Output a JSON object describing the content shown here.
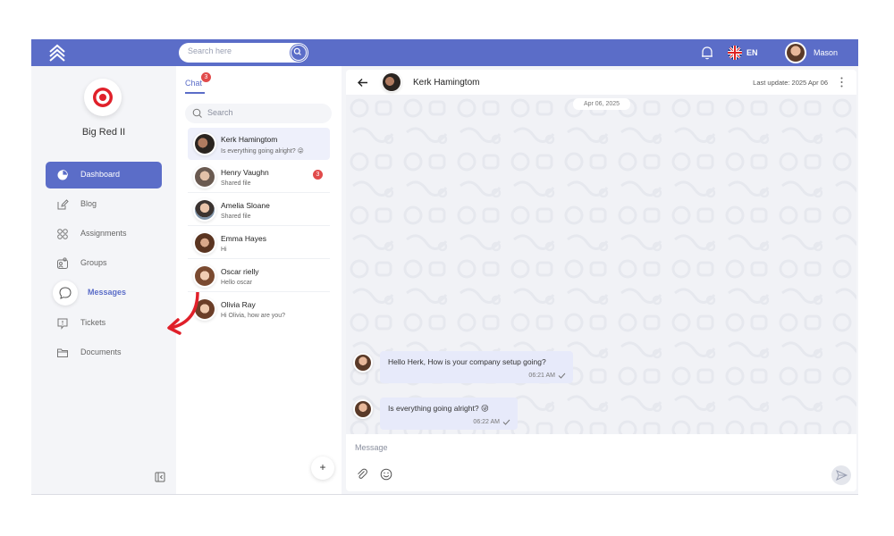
{
  "topbar": {
    "search_placeholder": "Search here",
    "language": "EN",
    "username": "Mason",
    "accent_color": "#5b6dc8"
  },
  "sidebar": {
    "brand_name": "Big Red II",
    "items": [
      {
        "label": "Dashboard",
        "icon": "pie-chart-icon"
      },
      {
        "label": "Blog",
        "icon": "edit-icon"
      },
      {
        "label": "Assignments",
        "icon": "grid-icon"
      },
      {
        "label": "Groups",
        "icon": "users-icon"
      },
      {
        "label": "Messages",
        "icon": "chat-bubble-icon"
      },
      {
        "label": "Tickets",
        "icon": "ticket-icon"
      },
      {
        "label": "Documents",
        "icon": "folder-icon"
      }
    ]
  },
  "chatlist": {
    "tab_label": "Chat",
    "tab_badge": "3",
    "search_placeholder": "Search",
    "contacts": [
      {
        "name": "Kerk Hamingtom",
        "preview": "Is everything going alright? 😜",
        "badge": ""
      },
      {
        "name": "Henry Vaughn",
        "preview": "Shared file",
        "badge": "3"
      },
      {
        "name": "Amelia Sloane",
        "preview": "Shared file",
        "badge": ""
      },
      {
        "name": "Emma Hayes",
        "preview": "Hi",
        "badge": ""
      },
      {
        "name": "Oscar rielly",
        "preview": "Hello oscar",
        "badge": ""
      },
      {
        "name": "Olivia Ray",
        "preview": "Hi Olivia, how are you?",
        "badge": ""
      }
    ],
    "add_label": "+"
  },
  "conversation": {
    "contact_name": "Kerk Hamingtom",
    "last_update": "Last update: 2025 Apr 06",
    "date_chip": "Apr 06, 2025",
    "messages": [
      {
        "text": "Hello Herk, How is your company setup going?",
        "time": "06:21 AM"
      },
      {
        "text": "Is everything going alright? 😜",
        "time": "06:22 AM"
      }
    ],
    "composer_placeholder": "Message"
  }
}
